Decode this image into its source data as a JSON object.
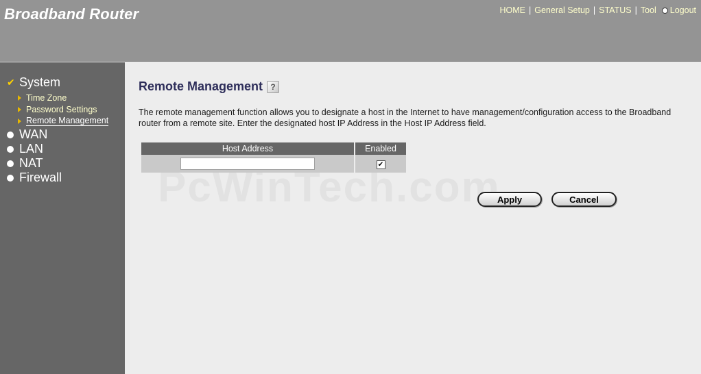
{
  "header": {
    "brand": "Broadband Router",
    "nav": {
      "home": "HOME",
      "general_setup": "General Setup",
      "status": "STATUS",
      "tool": "Tool",
      "logout": "Logout",
      "separator": "|"
    }
  },
  "sidebar": {
    "system": "System",
    "sub_items": [
      "Time Zone",
      "Password Settings",
      "Remote Management"
    ],
    "wan": "WAN",
    "lan": "LAN",
    "nat": "NAT",
    "firewall": "Firewall"
  },
  "main": {
    "title": "Remote Management",
    "help_glyph": "?",
    "description": "The remote management function allows you to designate a host in the Internet to have management/configuration access to the Broadband router from a remote site. Enter the designated host IP Address in the Host IP Address field.",
    "watermark": "PcWinTech.com",
    "table": {
      "headers": [
        "Host Address",
        "Enabled"
      ],
      "host_value": "",
      "enabled_mark": "✔"
    },
    "buttons": {
      "apply": "Apply",
      "cancel": "Cancel"
    }
  },
  "colors": {
    "header_bg": "#949494",
    "sidebar_bg": "#666666",
    "content_bg": "#ededed",
    "title": "#2e2e5a",
    "nav_text": "#ffffcc"
  }
}
